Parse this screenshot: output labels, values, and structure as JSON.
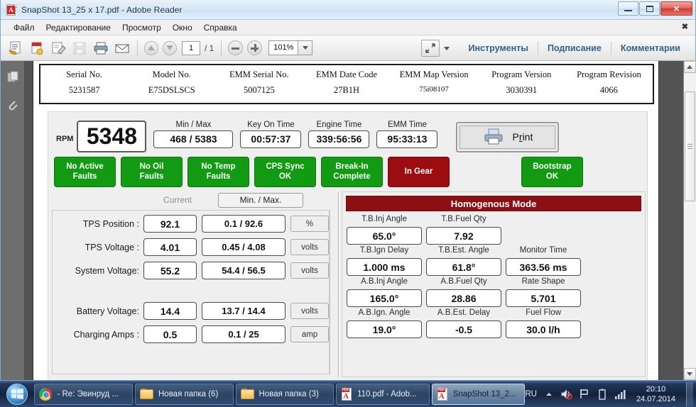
{
  "window": {
    "title": "SnapShot  13_25 x 17.pdf - Adobe Reader",
    "app_icon": "pdf-icon",
    "minimize": "minimize-icon",
    "maximize": "maximize-icon",
    "close": "close-icon"
  },
  "menu": {
    "items": [
      {
        "label": "Файл"
      },
      {
        "label": "Редактирование"
      },
      {
        "label": "Просмотр"
      },
      {
        "label": "Окно"
      },
      {
        "label": "Справка"
      }
    ],
    "close_glyph": "✖"
  },
  "toolbar": {
    "icons": [
      {
        "name": "open-export-icon"
      },
      {
        "name": "create-pdf-icon"
      },
      {
        "name": "edit-pdf-icon"
      },
      {
        "name": "save-icon"
      },
      {
        "name": "print-icon"
      },
      {
        "name": "email-icon"
      }
    ],
    "prev_page": "arrow-up-icon",
    "next_page": "arrow-down-icon",
    "page_current": "1",
    "page_total": "/ 1",
    "zoom_out": "zoom-out-icon",
    "zoom_in": "zoom-in-icon",
    "zoom_value": "101%",
    "zoom_dropdown": "chevron-down-icon",
    "fullscreen": "fullscreen-icon",
    "more_dropdown": "chevron-down-icon",
    "links": [
      {
        "label": "Инструменты"
      },
      {
        "label": "Подписание"
      },
      {
        "label": "Комментарии"
      }
    ]
  },
  "nav_panel": {
    "items": [
      {
        "name": "page-thumbnails-icon"
      },
      {
        "name": "attachments-icon"
      }
    ]
  },
  "document": {
    "header_table": [
      {
        "header": "Serial No.",
        "value": "5231587"
      },
      {
        "header": "Model No.",
        "value": "E75DSLSCS"
      },
      {
        "header": "EMM Serial No.",
        "value": "5007125"
      },
      {
        "header": "EMM Date Code",
        "value": "27B1H"
      },
      {
        "header": "EMM Map Version",
        "value": "75i08107"
      },
      {
        "header": "Program Version",
        "value": "3030391"
      },
      {
        "header": "Program Revision",
        "value": "4066"
      }
    ],
    "gauge_row": {
      "rpm_label": "RPM",
      "rpm_value": "5348",
      "minmax_caption": "Min / Max",
      "minmax_value": "468 / 5383",
      "key_on_caption": "Key On Time",
      "key_on_value": "00:57:37",
      "engine_caption": "Engine Time",
      "engine_value": "339:56:56",
      "emm_caption": "EMM Time",
      "emm_value": "95:33:13",
      "print_label_pre": "P",
      "print_label_u": "r",
      "print_label_post": "int",
      "print_icon": "printer-icon"
    },
    "status_buttons": [
      {
        "label_line1": "No Active",
        "label_line2": "Faults",
        "color": "#139a13"
      },
      {
        "label_line1": "No Oil",
        "label_line2": "Faults",
        "color": "#139a13"
      },
      {
        "label_line1": "No Temp",
        "label_line2": "Faults",
        "color": "#139a13"
      },
      {
        "label_line1": "CPS Sync",
        "label_line2": "OK",
        "color": "#139a13"
      },
      {
        "label_line1": "Break-In",
        "label_line2": "Complete",
        "color": "#139a13"
      },
      {
        "label_line1": "In Gear",
        "label_line2": "",
        "color": "#9c0d12"
      },
      {
        "label_line1": "",
        "label_line2": "",
        "color": "spacer"
      },
      {
        "label_line1": "Bootstrap",
        "label_line2": "OK",
        "color": "#139a13"
      }
    ],
    "left_panel": {
      "col_current": "Current",
      "col_minmax": "Min. / Max.",
      "rows": [
        {
          "label": "TPS Position :",
          "current": "92.1",
          "minmax": "0.1 / 92.6",
          "unit": "%"
        },
        {
          "label": "TPS Voltage :",
          "current": "4.01",
          "minmax": "0.45 / 4.08",
          "unit": "volts"
        },
        {
          "label": "System Voltage:",
          "current": "55.2",
          "minmax": "54.4 / 56.5",
          "unit": "volts"
        },
        {
          "label": "Battery Voltage:",
          "current": "14.4",
          "minmax": "13.7 / 14.4",
          "unit": "volts"
        },
        {
          "label": "Charging Amps :",
          "current": "0.5",
          "minmax": "0.1 / 25",
          "unit": "amp"
        }
      ]
    },
    "right_panel": {
      "title": "Homogenous Mode",
      "title_bg": "#8b0f13",
      "rows": [
        [
          {
            "caption": "T.B.Inj Angle",
            "value": "65.0°"
          },
          {
            "caption": "T.B.Fuel Qty",
            "value": "7.92"
          },
          {
            "caption": "",
            "value": ""
          }
        ],
        [
          {
            "caption": "T.B.Ign Delay",
            "value": "1.000 ms"
          },
          {
            "caption": "T.B.Est. Angle",
            "value": "61.8°"
          },
          {
            "caption": "Monitor Time",
            "value": "363.56 ms"
          }
        ],
        [
          {
            "caption": "A.B.Inj Angle",
            "value": "165.0°"
          },
          {
            "caption": "A.B.Fuel Qty",
            "value": "28.86"
          },
          {
            "caption": "Rate Shape",
            "value": "5.701"
          }
        ],
        [
          {
            "caption": "A.B.Ign. Angle",
            "value": "19.0°"
          },
          {
            "caption": "A.B.Est. Delay",
            "value": "-0.5"
          },
          {
            "caption": "Fuel Flow",
            "value": "30.0 l/h"
          }
        ]
      ]
    }
  },
  "scrollbar": {
    "up": "scroll-up-icon",
    "down": "scroll-down-icon"
  },
  "taskbar": {
    "start": "windows-start-orb",
    "tasks": [
      {
        "label": "- Re: Эвинруд ...",
        "icon": "chrome-icon",
        "active": false
      },
      {
        "label": "Новая папка (6)",
        "icon": "folder-icon",
        "active": false
      },
      {
        "label": "Новая папка (3)",
        "icon": "folder-icon",
        "active": false
      },
      {
        "label": "110.pdf - Adob...",
        "icon": "pdf-icon",
        "active": false
      },
      {
        "label": "SnapShot  13_2...",
        "icon": "pdf-icon",
        "active": true
      }
    ],
    "tray": {
      "language": "RU",
      "show_hidden": "chevron-up-icon",
      "volume": "volume-muted-icon",
      "action_center": "flag-icon",
      "battery": "battery-icon",
      "network": "network-bars-icon",
      "time": "20:10",
      "date": "24.07.2014"
    }
  }
}
